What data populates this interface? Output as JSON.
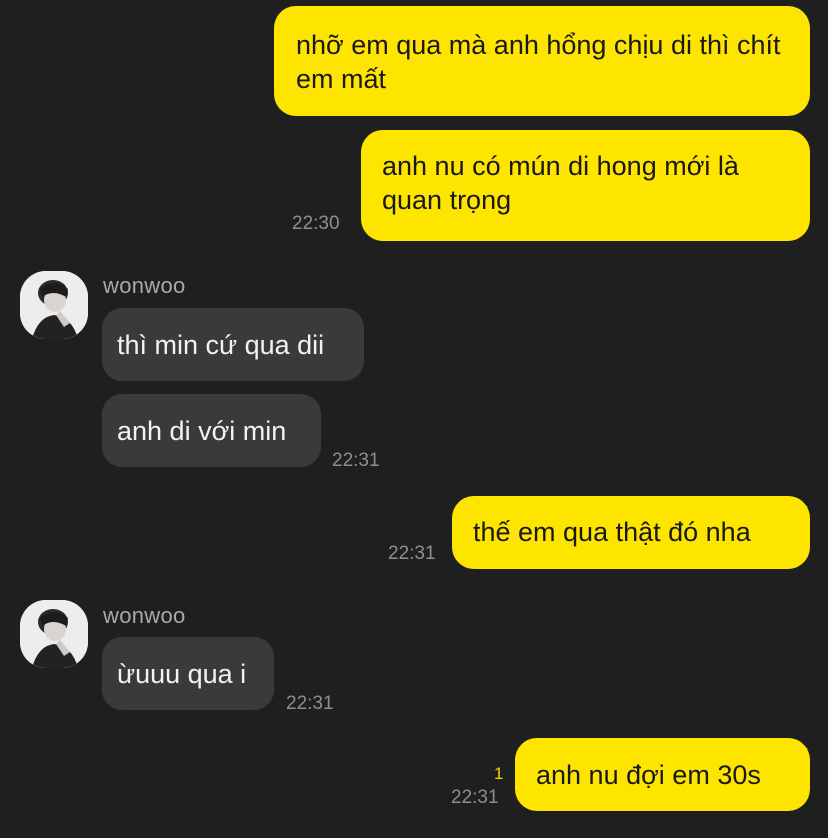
{
  "messages": [
    {
      "sender": "",
      "text": "nhỡ em qua mà anh hổng chịu di thì chít em mất",
      "time": "",
      "unread": ""
    },
    {
      "sender": "",
      "text": "anh nu có mún di hong mới là quan trọng",
      "time": "22:30",
      "unread": ""
    },
    {
      "sender": "wonwoo",
      "text": "thì min cứ qua dii",
      "time": "",
      "unread": ""
    },
    {
      "sender": "",
      "text": "anh di với min",
      "time": "22:31",
      "unread": ""
    },
    {
      "sender": "",
      "text": "thế em qua thật đó nha",
      "time": "22:31",
      "unread": ""
    },
    {
      "sender": "wonwoo",
      "text": "ừuuu qua i",
      "time": "22:31",
      "unread": ""
    },
    {
      "sender": "",
      "text": "anh nu đợi em 30s",
      "time": "22:31",
      "unread": "1"
    }
  ],
  "colors": {
    "background": "#1f1f1f",
    "outgoing_bubble": "#fee500",
    "incoming_bubble": "#3a3a3c",
    "timestamp": "#8e8e93",
    "unread_count": "#f5d400"
  },
  "icons": {
    "avatar": "profile-photo"
  }
}
